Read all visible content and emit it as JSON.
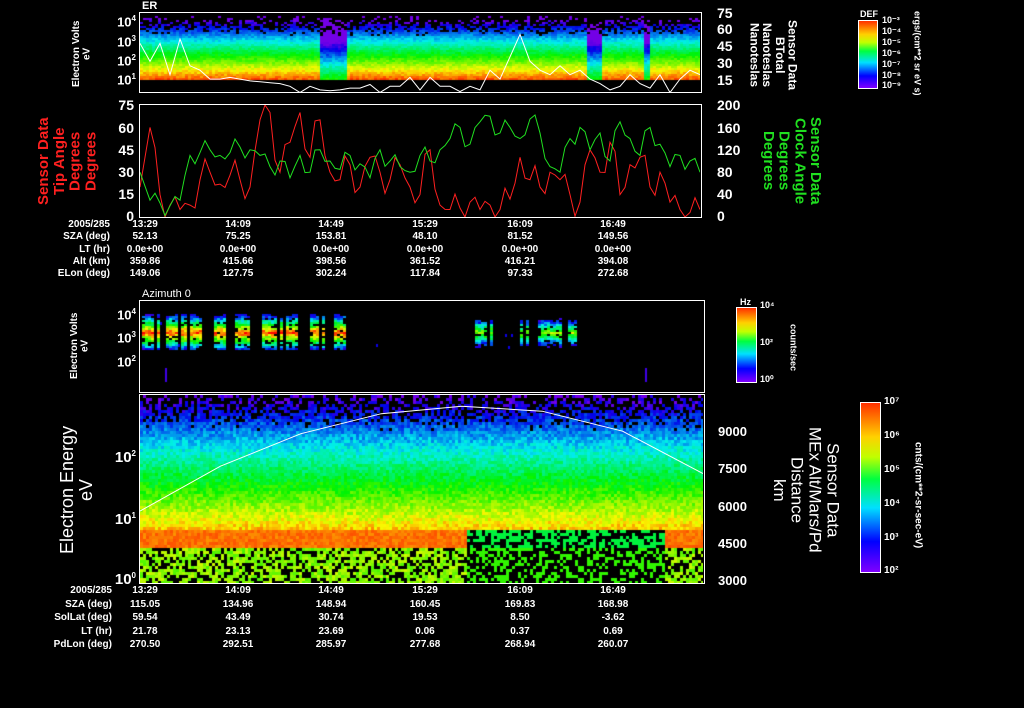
{
  "panel1": {
    "title": "ER",
    "ylabel": [
      "Electron Volts",
      "eV"
    ],
    "y_ticks": [
      "4",
      "3",
      "2",
      "1"
    ],
    "y_tick_base": "10",
    "right_ticks": [
      "75",
      "60",
      "45",
      "30",
      "15"
    ],
    "right_label": [
      "Sensor Data",
      "BTotal",
      "Nanoteslas",
      "Nanoteslas"
    ],
    "colorbar": {
      "title": "DEF",
      "labels": [
        "10⁻³",
        "10⁻⁴",
        "10⁻⁵",
        "10⁻⁶",
        "10⁻⁷",
        "10⁻⁸",
        "10⁻⁹"
      ],
      "units": "ergs/(cm**2 sr eV s)"
    }
  },
  "panel2": {
    "left_label": [
      "Sensor Data",
      "Tip Angle",
      "Degrees",
      "Degrees"
    ],
    "left_ticks": [
      "75",
      "60",
      "45",
      "30",
      "15",
      "0"
    ],
    "right_label": [
      "Sensor Data",
      "Clock Angle",
      "Degrees",
      "Degrees"
    ],
    "right_ticks": [
      "200",
      "160",
      "120",
      "80",
      "40",
      "0"
    ],
    "left_color": "#ff2020",
    "right_color": "#20e020"
  },
  "table1": {
    "labels": [
      "2005/285",
      "SZA (deg)",
      "LT (hr)",
      "Alt (km)",
      "ELon (deg)"
    ],
    "rows": [
      [
        "13:29",
        "14:09",
        "14:49",
        "15:29",
        "16:09",
        "16:49"
      ],
      [
        "52.13",
        "75.25",
        "153.81",
        "48.10",
        "81.52",
        "149.56"
      ],
      [
        "0.0e+00",
        "0.0e+00",
        "0.0e+00",
        "0.0e+00",
        "0.0e+00",
        "0.0e+00"
      ],
      [
        "359.86",
        "415.66",
        "398.56",
        "361.52",
        "416.21",
        "394.08"
      ],
      [
        "149.06",
        "127.75",
        "302.24",
        "117.84",
        "97.33",
        "272.68"
      ]
    ]
  },
  "panel3": {
    "title": "Azimuth 0",
    "ylabel": [
      "Electron Volts",
      "eV"
    ],
    "y_ticks": [
      "4",
      "3",
      "2"
    ],
    "y_tick_base": "10",
    "colorbar": {
      "title": "Hz",
      "labels": [
        "10⁴",
        "10²",
        "10⁰"
      ],
      "units": "counts/sec"
    }
  },
  "panel4": {
    "ylabel": [
      "Electron Energy",
      "eV"
    ],
    "y_ticks": [
      "2",
      "1",
      "0"
    ],
    "y_tick_base": "10",
    "right_ticks": [
      "9000",
      "7500",
      "6000",
      "4500",
      "3000"
    ],
    "right_label": [
      "Sensor Data",
      "MEx Alt/Mars/Pd",
      "Distance",
      "km"
    ],
    "colorbar": {
      "labels": [
        "10⁷",
        "10⁶",
        "10⁵",
        "10⁴",
        "10³",
        "10²"
      ],
      "units": "cnts/(cm**2-sr-sec-eV)"
    }
  },
  "table2": {
    "labels": [
      "2005/285",
      "SZA (deg)",
      "SolLat (deg)",
      "LT (hr)",
      "PdLon (deg)"
    ],
    "rows": [
      [
        "13:29",
        "14:09",
        "14:49",
        "15:29",
        "16:09",
        "16:49"
      ],
      [
        "115.05",
        "134.96",
        "148.94",
        "160.45",
        "169.83",
        "168.98"
      ],
      [
        "59.54",
        "43.49",
        "30.74",
        "19.53",
        "8.50",
        "-3.62"
      ],
      [
        "21.78",
        "23.13",
        "23.69",
        "0.06",
        "0.37",
        "0.69"
      ],
      [
        "270.50",
        "292.51",
        "285.97",
        "277.68",
        "268.94",
        "260.07"
      ]
    ]
  },
  "chart_data": [
    {
      "type": "heatmap",
      "title": "ER",
      "ylabel": "Electron Volts (eV)",
      "yscale": "log",
      "ylim": [
        5,
        20000
      ],
      "overlay": {
        "name": "BTotal (nT)",
        "ylim": [
          0,
          75
        ],
        "values": [
          60,
          40,
          60,
          25,
          65,
          35,
          30,
          20,
          20,
          22,
          20,
          18,
          17,
          16,
          15,
          12,
          5,
          12,
          8,
          7,
          8,
          10,
          10,
          14,
          5,
          12,
          12,
          22,
          8,
          22,
          12,
          12,
          6,
          12,
          8,
          30,
          20,
          45,
          70,
          40,
          30,
          25,
          35,
          25,
          30,
          20,
          15,
          8,
          12,
          25,
          15,
          10,
          25,
          5,
          20,
          30,
          25
        ]
      }
    },
    {
      "type": "line",
      "x_range": [
        "13:29",
        "17:29"
      ],
      "series": [
        {
          "name": "Tip Angle (deg)",
          "axis": "left",
          "ylim": [
            0,
            75
          ],
          "color": "#ff2020",
          "values": [
            20,
            60,
            15,
            8,
            5,
            8,
            25,
            30,
            22,
            28,
            25,
            20,
            65,
            70,
            30,
            50,
            70,
            40,
            65,
            30,
            25,
            35,
            20,
            40,
            30,
            25,
            35,
            20,
            15,
            45,
            8,
            5,
            6,
            10,
            5,
            8,
            5,
            12,
            40,
            25,
            20,
            30,
            25,
            15,
            10,
            45,
            30,
            50,
            15,
            35,
            40,
            20,
            30,
            10,
            5,
            3,
            5
          ]
        },
        {
          "name": "Clock Angle (deg)",
          "axis": "right",
          "ylim": [
            0,
            200
          ],
          "color": "#20e020",
          "values": [
            80,
            30,
            25,
            20,
            30,
            110,
            115,
            120,
            110,
            115,
            125,
            120,
            110,
            90,
            100,
            70,
            110,
            80,
            120,
            100,
            85,
            110,
            95,
            70,
            120,
            100,
            90,
            80,
            110,
            100,
            120,
            140,
            160,
            130,
            170,
            180,
            150,
            160,
            140,
            175,
            150,
            90,
            80,
            140,
            160,
            120,
            150,
            100,
            170,
            140,
            110,
            160,
            130,
            90,
            110,
            100,
            80
          ]
        }
      ]
    },
    {
      "type": "heatmap",
      "title": "Azimuth 0",
      "ylabel": "Electron Volts (eV)",
      "yscale": "log",
      "ylim": [
        20,
        20000
      ]
    },
    {
      "type": "heatmap",
      "ylabel": "Electron Energy (eV)",
      "yscale": "log",
      "ylim": [
        1,
        800
      ],
      "overlay": {
        "name": "MEx Alt/Mars/Pd Distance (km)",
        "ylim": [
          3000,
          10450
        ],
        "values": [
          5800,
          7600,
          8900,
          9700,
          10000,
          9800,
          9000,
          7300
        ]
      }
    }
  ]
}
